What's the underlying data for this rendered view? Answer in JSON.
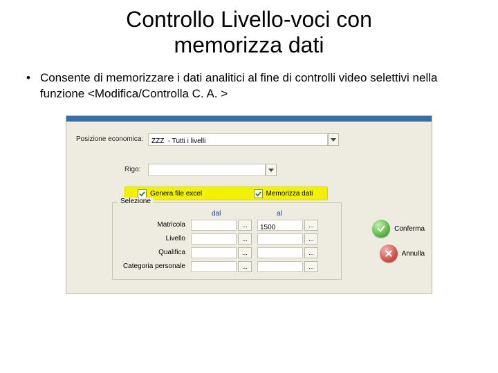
{
  "title_line1": "Controllo Livello-voci con",
  "title_line2": "memorizza dati",
  "bullet": "Consente di memorizzare i dati analitici al fine di controlli video selettivi nella funzione <Modifica/Controlla C. A. >",
  "form": {
    "posizione_label": "Posizione economica:",
    "posizione_value": "ZZZ  - Tutti i livelli",
    "rigo_label": "Rigo:",
    "rigo_value": "",
    "cb_excel": "Genera file excel",
    "cb_memo": "Memorizza dati",
    "panel_title": "Selezione",
    "col_dal": "dal",
    "col_al": "al",
    "rows": {
      "matricola": "Matricola",
      "livello": "Livello",
      "qualifica": "Qualifica",
      "categoria": "Categoria personale"
    },
    "matricola_al": "1500",
    "ellipsis": "...",
    "conferma": "Conferma",
    "annulla": "Annulla"
  }
}
